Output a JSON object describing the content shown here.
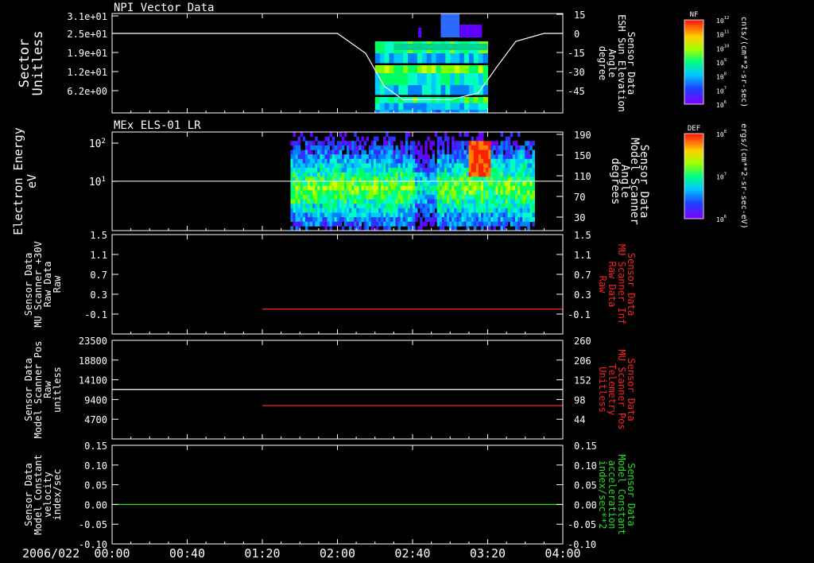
{
  "date_label": "2006/022",
  "colors": {
    "white": "#ffffff",
    "red": "#ff2020",
    "green": "#20e020",
    "background": "#000000"
  },
  "time_axis": {
    "range": [
      "00:00",
      "04:00"
    ],
    "tick_labels": [
      "00:00",
      "00:40",
      "01:20",
      "02:00",
      "02:40",
      "03:20",
      "04:00"
    ]
  },
  "colorbars": [
    {
      "title": "NF",
      "tick_labels": [
        "10^12",
        "10^11",
        "10^10",
        "10^9",
        "10^8",
        "10^7",
        "10^6"
      ],
      "unit_label": "cnts/(cm**2-sr-sec)"
    },
    {
      "title": "DEF",
      "tick_labels": [
        "10^8",
        "10^7",
        "10^6"
      ],
      "unit_label": "ergs/(cm**2-sr-sec-eV)"
    }
  ],
  "chart_data": [
    {
      "type": "heatmap",
      "title": "NPI Vector Data",
      "ylabel": [
        "Sector",
        "Unitless"
      ],
      "y_tick_labels": [
        "3.1e+01",
        "2.5e+01",
        "1.9e+01",
        "1.2e+01",
        "6.2e+00"
      ],
      "right_ylabel": [
        "Sensor Data",
        "ESH Sun Elevation",
        "Angle",
        "degree"
      ],
      "right_tick_labels": [
        "15",
        "0",
        "-15",
        "-30",
        "-45"
      ],
      "ylim_right": [
        -60,
        15
      ],
      "data_span_time": [
        "02:20",
        "03:20"
      ],
      "overlay_line": {
        "name": "ESH Sun Elevation Angle",
        "t": [
          "00:00",
          "02:00",
          "02:15",
          "02:25",
          "02:35",
          "03:00",
          "03:15",
          "03:25",
          "03:35",
          "03:50",
          "04:00"
        ],
        "values": [
          0,
          0,
          -15,
          -40,
          -50,
          -50,
          -45,
          -25,
          -6,
          0,
          0
        ]
      },
      "colorbar": "NF"
    },
    {
      "type": "heatmap",
      "title": "MEx ELS-01 LR",
      "ylabel": [
        "Electron Energy",
        "eV"
      ],
      "y_tick_labels": [
        "10^2",
        "10^1"
      ],
      "ylim": [
        1,
        200
      ],
      "yscale": "log",
      "right_ylabel": [
        "Sensor Data",
        "Model Scanner",
        "Angle",
        "degrees"
      ],
      "right_tick_labels": [
        "190",
        "150",
        "110",
        "70",
        "30"
      ],
      "ylim_right": [
        10,
        190
      ],
      "data_span_time": [
        "01:35",
        "03:45"
      ],
      "overlay_line": {
        "name": "Model Scanner Angle",
        "values": [
          90
        ]
      },
      "colorbar": "DEF"
    },
    {
      "type": "line",
      "ylabel": [
        "Sensor Data",
        "MU Scanner +30V",
        "Raw Data",
        "Raw"
      ],
      "y_tick_labels": [
        "1.5",
        "1.1",
        "0.7",
        "0.3",
        "-0.1"
      ],
      "ylim": [
        -0.5,
        1.5
      ],
      "right_ylabel": [
        "Sensor Data",
        "MU Scanner Inf",
        "Raw Data",
        "Raw"
      ],
      "right_tick_labels": [
        "1.5",
        "1.1",
        "0.7",
        "0.3",
        "-0.1"
      ],
      "series": [
        {
          "name": "MU Scanner Inf",
          "t": [
            "01:20",
            "04:00"
          ],
          "values": [
            0.0,
            0.0
          ],
          "color": "red"
        }
      ]
    },
    {
      "type": "line",
      "ylabel": [
        "Sensor Data",
        "Model Scanner Pos",
        "Raw",
        "unitless"
      ],
      "y_tick_labels": [
        "23500",
        "18800",
        "14100",
        "9400",
        "4700"
      ],
      "ylim": [
        0,
        23500
      ],
      "right_ylabel": [
        "Sensor Data",
        "MU Scanner Pos",
        "Telemetry",
        "Unitless"
      ],
      "right_tick_labels": [
        "260",
        "206",
        "152",
        "98",
        "44"
      ],
      "ylim_right": [
        0,
        260
      ],
      "series": [
        {
          "name": "Model Scanner Pos",
          "t": [
            "00:00",
            "04:00"
          ],
          "values": [
            11800,
            11800
          ],
          "color": "white"
        },
        {
          "name": "MU Scanner Pos",
          "t": [
            "01:20",
            "04:00"
          ],
          "values": [
            88,
            88
          ],
          "color": "red",
          "axis": "right"
        }
      ]
    },
    {
      "type": "line",
      "ylabel": [
        "Sensor Data",
        "Model Constant",
        "velocity",
        "index/sec"
      ],
      "y_tick_labels": [
        "0.15",
        "0.10",
        "0.05",
        "0.00",
        "-0.05",
        "-0.10"
      ],
      "ylim": [
        -0.1,
        0.15
      ],
      "right_ylabel": [
        "Sensor Data",
        "Model Constant",
        "acceleration",
        "index/sec**2"
      ],
      "right_tick_labels": [
        "0.15",
        "0.10",
        "0.05",
        "0.00",
        "-0.05",
        "-0.10"
      ],
      "series": [
        {
          "name": "Model Constant acceleration",
          "t": [
            "00:00",
            "04:00"
          ],
          "values": [
            0.0,
            0.0
          ],
          "color": "green"
        }
      ]
    }
  ]
}
